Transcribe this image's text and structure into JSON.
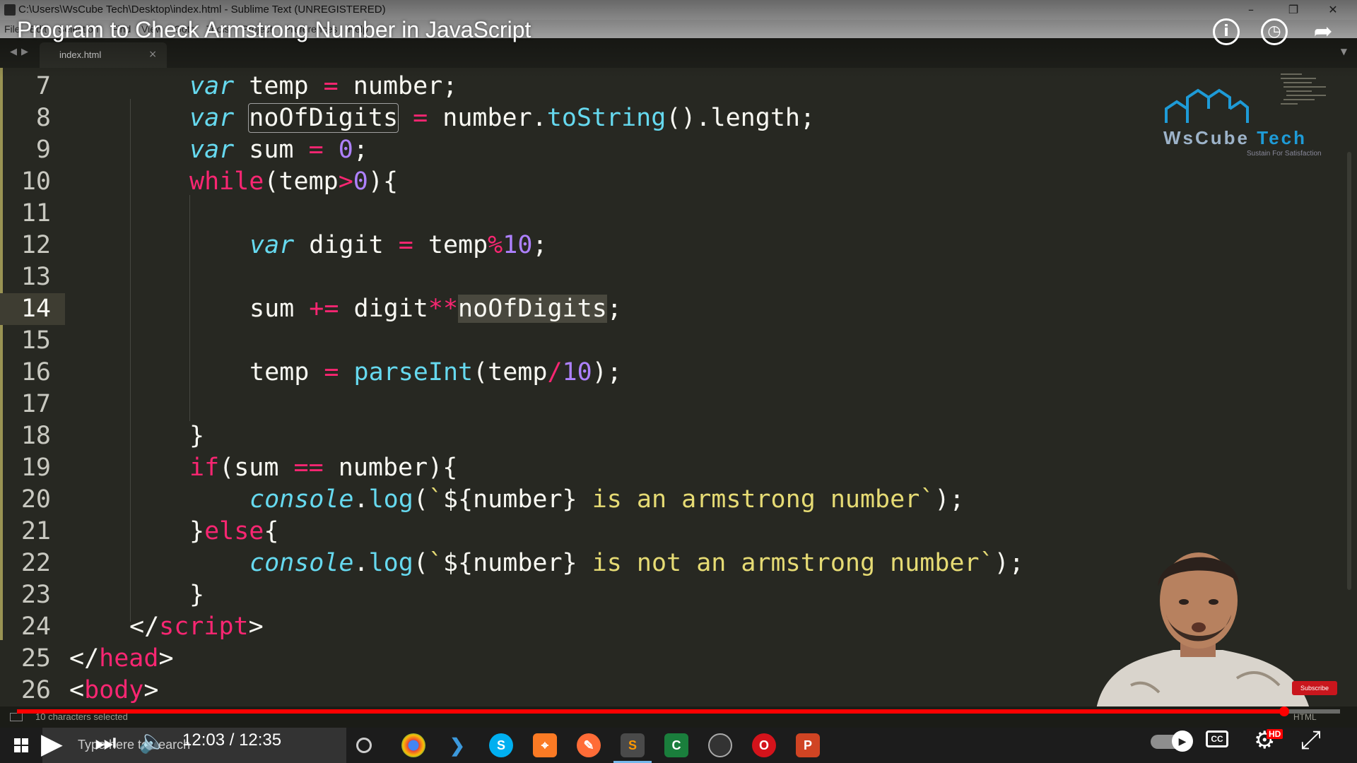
{
  "window": {
    "title": "C:\\Users\\WsCube Tech\\Desktop\\index.html - Sublime Text (UNREGISTERED)",
    "menu": [
      "File",
      "Edit",
      "Selection",
      "Find",
      "View",
      "Goto",
      "Tools",
      "Project",
      "Preferences",
      "Help"
    ]
  },
  "video": {
    "title": "Program to Check Armstrong Number in JavaScript",
    "time": "12:03 / 12:35",
    "progress": 0.9576
  },
  "tab": {
    "label": "index.html",
    "close": "×"
  },
  "editor": {
    "line_numbers": [
      "7",
      "8",
      "9",
      "10",
      "11",
      "12",
      "13",
      "14",
      "15",
      "16",
      "17",
      "18",
      "19",
      "20",
      "21",
      "22",
      "23",
      "24",
      "25",
      "26"
    ],
    "active_line": "14",
    "lines": {
      "l7": {
        "kw": "var",
        "rest": " temp ",
        "op": "=",
        "rest2": " number;"
      },
      "l8": {
        "kw": "var",
        "sp": " ",
        "ident": "noOfDigits",
        "sp2": " ",
        "op": "=",
        "rest": " number.",
        "fn": "toString",
        "rest2": "().length;"
      },
      "l9": {
        "kw": "var",
        "rest": " sum ",
        "op": "=",
        "sp": " ",
        "num": "0",
        "end": ";"
      },
      "l10": {
        "kw": "while",
        "rest": "(temp",
        "op": ">",
        "num": "0",
        "end": "){"
      },
      "l12": {
        "kw": "var",
        "rest": " digit ",
        "op": "=",
        "rest2": " temp",
        "op2": "%",
        "num": "10",
        "end": ";"
      },
      "l14": {
        "a": "sum ",
        "op": "+=",
        "b": " digit",
        "op2": "**",
        "sel": "noOfDigits",
        "end": ";"
      },
      "l16": {
        "a": "temp ",
        "op": "=",
        "sp": " ",
        "fn": "parseInt",
        "b": "(temp",
        "op2": "/",
        "num": "10",
        "end": ");"
      },
      "l18": {
        "a": "}"
      },
      "l19": {
        "kw": "if",
        "a": "(sum ",
        "op": "==",
        "b": " number){"
      },
      "l20": {
        "obj": "console",
        "dot": ".",
        "fn": "log",
        "open": "(",
        "str1": "`",
        "tpl": "${number}",
        "str2": " is an armstrong number`",
        "close": ");"
      },
      "l21": {
        "a": "}",
        "kw": "else",
        "b": "{"
      },
      "l22": {
        "obj": "console",
        "dot": ".",
        "fn": "log",
        "open": "(",
        "str1": "`",
        "tpl": "${number}",
        "str2": " is not an armstrong number`",
        "close": ");"
      },
      "l23": {
        "a": "}"
      },
      "l24": {
        "open": "</",
        "tag": "script",
        "close": ">"
      },
      "l25": {
        "open": "</",
        "tag": "head",
        "close": ">"
      },
      "l26": {
        "open": "<",
        "tag": "body",
        "close": ">"
      }
    }
  },
  "logo": {
    "name_a": "WsCube ",
    "name_b": "Tech",
    "tagline": "Sustain For Satisfaction"
  },
  "status": {
    "text": "10 characters selected",
    "syntax": "HTML"
  },
  "taskbar": {
    "search_placeholder": "Type here to search",
    "apps": [
      "cortana-icon",
      "chrome-icon",
      "vscode-icon",
      "skype-icon",
      "xampp-icon",
      "postman-icon",
      "sublime-icon",
      "camtasia-icon",
      "obs-icon",
      "opera-icon",
      "powerpoint-icon"
    ]
  },
  "overlay": {
    "subscribe": "Subscribe",
    "hd": "HD",
    "cc": "CC"
  },
  "colors": {
    "keyword": "#f92672",
    "storage": "#66d9ef",
    "number": "#ae81ff",
    "string": "#e6db74",
    "background": "#272822",
    "progress": "#ff0000"
  }
}
